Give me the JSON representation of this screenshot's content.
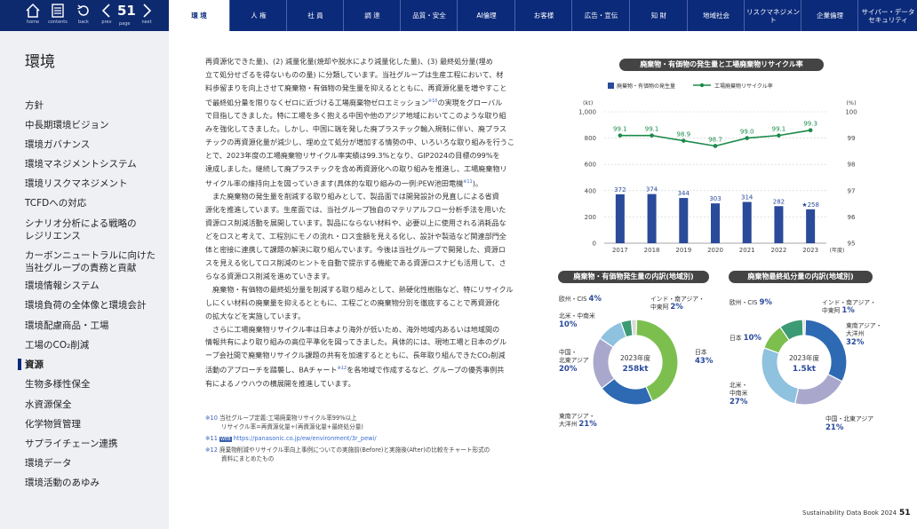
{
  "nav": {
    "home_label": "home",
    "contents_label": "contents",
    "back_label": "back",
    "prev_label": "prev",
    "page_label": "page",
    "next_label": "next",
    "page_number": "51"
  },
  "tabs": [
    "環 境",
    "人 権",
    "社 員",
    "調 達",
    "品質・安全",
    "AI倫理",
    "お客様",
    "広告・宣伝",
    "知 財",
    "地域社会",
    "リスクマネジメント",
    "企業倫理",
    "サイバー・データ\nセキュリティ"
  ],
  "sidebar": {
    "title": "環境",
    "items": [
      "方針",
      "中長期環境ビジョン",
      "環境ガバナンス",
      "環境マネジメントシステム",
      "環境リスクマネジメント",
      "TCFDへの対応",
      "シナリオ分析による戦略の\nレジリエンス",
      "カーボンニュートラルに向けた\n当社グループの責務と貢献",
      "環境情報システム",
      "環境負荷の全体像と環境会計",
      "環境配慮商品・工場",
      "工場のCO₂削減",
      "資源",
      "生物多様性保全",
      "水資源保全",
      "化学物質管理",
      "サプライチェーン連携",
      "環境データ",
      "環境活動のあゆみ"
    ]
  },
  "body": {
    "para1_l1": "再資源化できた量)、(2) 減量化量(焼却や脱水により減量化した量)、(3) 最終処分量(埋め",
    "para1_l2": "立て処分せざるを得ないものの量) に分類しています。当社グループは生産工程において、材",
    "para1_l3": "料歩留まりを向上させて廃棄物・有価物の発生量を抑えるとともに、再資源化量を増やすこと",
    "para1_l4a": "で最終処分量を限りなくゼロに近づける工場廃棄物ゼロエミッション",
    "para1_l4sup": "※10",
    "para1_l4b": "の実現をグローバル",
    "para1_l5": "で目指してきました。特に工場を多く抱える中国や他のアジア地域においてこのような取り組",
    "para1_l6": "みを強化してきました。しかし、中国に端を発した廃プラスチック輸入規制に伴い、廃プラス",
    "para1_l7": "チックの再資源化量が減少し、埋め立て処分が増加する情勢の中、いろいろな取り組みを行うこ",
    "para1_l8": "とで、2023年度の工場廃棄物リサイクル率実績は99.3%となり、GIP2024の目標の99%を",
    "para1_l9": "達成しました。継続して廃プラスチックを含め再資源化への取り組みを推進し、工場廃棄物リ",
    "para1_l10a": "サイクル率の維持向上を図っていきます(具体的な取り組みの一例:PEW池田電機",
    "para1_l10sup": "※11",
    "para1_l10b": ")。",
    "para2_l1": "また廃棄物の発生量を削減する取り組みとして、製品面では開発設計の見直しによる省資",
    "para2_l2": "源化を推進しています。生産面では、当社グループ独自のマテリアルフロー分析手法を用いた",
    "para2_l3": "資源ロス削減活動を展開しています。製品にならない材料や、必要以上に使用される消耗品な",
    "para2_l4": "どをロスと考えて、工程別にモノの流れ・ロス金額を見える化し、設計や製造など関連部門全",
    "para2_l5": "体と密接に連携して課題の解決に取り組んでいます。今後は当社グループで開発した、資源ロ",
    "para2_l6": "スを見える化してロス削減のヒントを自動で提示する機能である資源ロスナビも活用して、さ",
    "para2_l7": "らなる資源ロス削減を進めていきます。",
    "para3_l1": "廃棄物・有価物の最終処分量を削減する取り組みとして、熱硬化性樹脂など、特にリサイクル",
    "para3_l2": "しにくい材料の廃棄量を抑えるとともに、工程ごとの廃棄物分別を徹底することで再資源化",
    "para3_l3": "の拡大などを実施しています。",
    "para4_l1": "さらに工場廃棄物リサイクル率は日本より海外が低いため、海外地域内あるいは地域間の",
    "para4_l2": "情報共有により取り組みの高位平準化を図ってきました。具体的には、現地工場と日本のグル",
    "para4_l3": "ープ会社間で廃棄物リサイクル課題の共有を加速するとともに、長年取り組んできたCO₂削減",
    "para4_l4a": "活動のアプローチを踏襲し、BAチャート",
    "para4_l4sup": "※12",
    "para4_l4b": "を各地域で作成するなど、グループの優秀事例共",
    "para4_l5": "有によるノウハウの横展開を推進しています。"
  },
  "notes": {
    "n10_mark": "※10",
    "n10_l1": "当社グループ定義:工場廃棄物リサイクル率99%以上",
    "n10_l2": "リサイクル率=再資源化量÷(再資源化量+最終処分量)",
    "n11_mark": "※11",
    "n11_badge": "WEB",
    "n11_url": "https://panasonic.co.jp/ew/environment/3r_pewi/",
    "n12_mark": "※12",
    "n12_l1": "廃棄物削減やリサイクル率向上事例についての実施前(Before)と実施後(After)の比較をチャート形式の",
    "n12_l2": "資料にまとめたもの"
  },
  "footer": {
    "book": "Sustainability Data Book 2024",
    "page": "51"
  },
  "chart_data": [
    {
      "type": "bar",
      "title": "廃棄物・有価物の発生量と工場廃棄物リサイクル率",
      "categories": [
        "2017",
        "2018",
        "2019",
        "2020",
        "2021",
        "2022",
        "2023"
      ],
      "series": [
        {
          "name": "廃棄物・有価物の発生量",
          "type": "bar",
          "values": [
            372,
            374,
            344,
            303,
            314,
            282,
            258
          ],
          "labels": [
            "372",
            "374",
            "344",
            "303",
            "314",
            "282",
            "★258"
          ],
          "color": "#2a4a9a",
          "axis": "left"
        },
        {
          "name": "工場廃棄物リサイクル率",
          "type": "line",
          "values": [
            99.1,
            99.1,
            98.9,
            98.7,
            99.0,
            99.1,
            99.3
          ],
          "labels": [
            "99.1",
            "99.1",
            "98.9",
            "98.7",
            "99.0",
            "99.1",
            "99.3"
          ],
          "color": "#1a8a4a",
          "axis": "right"
        }
      ],
      "left_unit": "(kt)",
      "right_unit": "(%)",
      "left_ticks": [
        "0",
        "200",
        "400",
        "600",
        "800",
        "1,000"
      ],
      "right_ticks": [
        "95",
        "96",
        "97",
        "98",
        "99",
        "100"
      ],
      "ylim": [
        0,
        1000
      ],
      "y2lim": [
        95,
        100
      ],
      "x_unit": "(年度)",
      "legend": "top-left"
    },
    {
      "type": "pie",
      "title": "廃棄物・有価物発生量の内訳(地域別)",
      "center_l1": "2023年度",
      "center_l2": "258kt",
      "slices": [
        {
          "label": "日本",
          "value": 43,
          "text": "43%",
          "color": "#7cbf4f"
        },
        {
          "label": "東南アジア・大洋州",
          "value": 21,
          "text": "21%",
          "color": "#2e69b3"
        },
        {
          "label": "中国・北東アジア",
          "value": 20,
          "text": "20%",
          "color": "#a9a8cc"
        },
        {
          "label": "北米・中南米",
          "value": 10,
          "text": "10%",
          "color": "#8ec2de"
        },
        {
          "label": "欧州・CIS",
          "value": 4,
          "text": "4%",
          "color": "#3c9b74"
        },
        {
          "label": "インド・南アジア・中東阿",
          "value": 2,
          "text": "2%",
          "color": "#d9d9d9"
        }
      ]
    },
    {
      "type": "pie",
      "title": "廃棄物最終処分量の内訳(地域別)",
      "center_l1": "2023年度",
      "center_l2": "1.5kt",
      "slices": [
        {
          "label": "東南アジア・大洋州",
          "value": 32,
          "text": "32%",
          "color": "#2e69b3"
        },
        {
          "label": "中国・北東アジア",
          "value": 21,
          "text": "21%",
          "color": "#a9a8cc"
        },
        {
          "label": "北米・中南米",
          "value": 27,
          "text": "27%",
          "color": "#8ec2de"
        },
        {
          "label": "日本",
          "value": 10,
          "text": "10%",
          "color": "#7cbf4f"
        },
        {
          "label": "欧州・CIS",
          "value": 9,
          "text": "9%",
          "color": "#3c9b74"
        },
        {
          "label": "インド・南アジア・中東阿",
          "value": 1,
          "text": "1%",
          "color": "#d9d9d9"
        }
      ]
    }
  ]
}
